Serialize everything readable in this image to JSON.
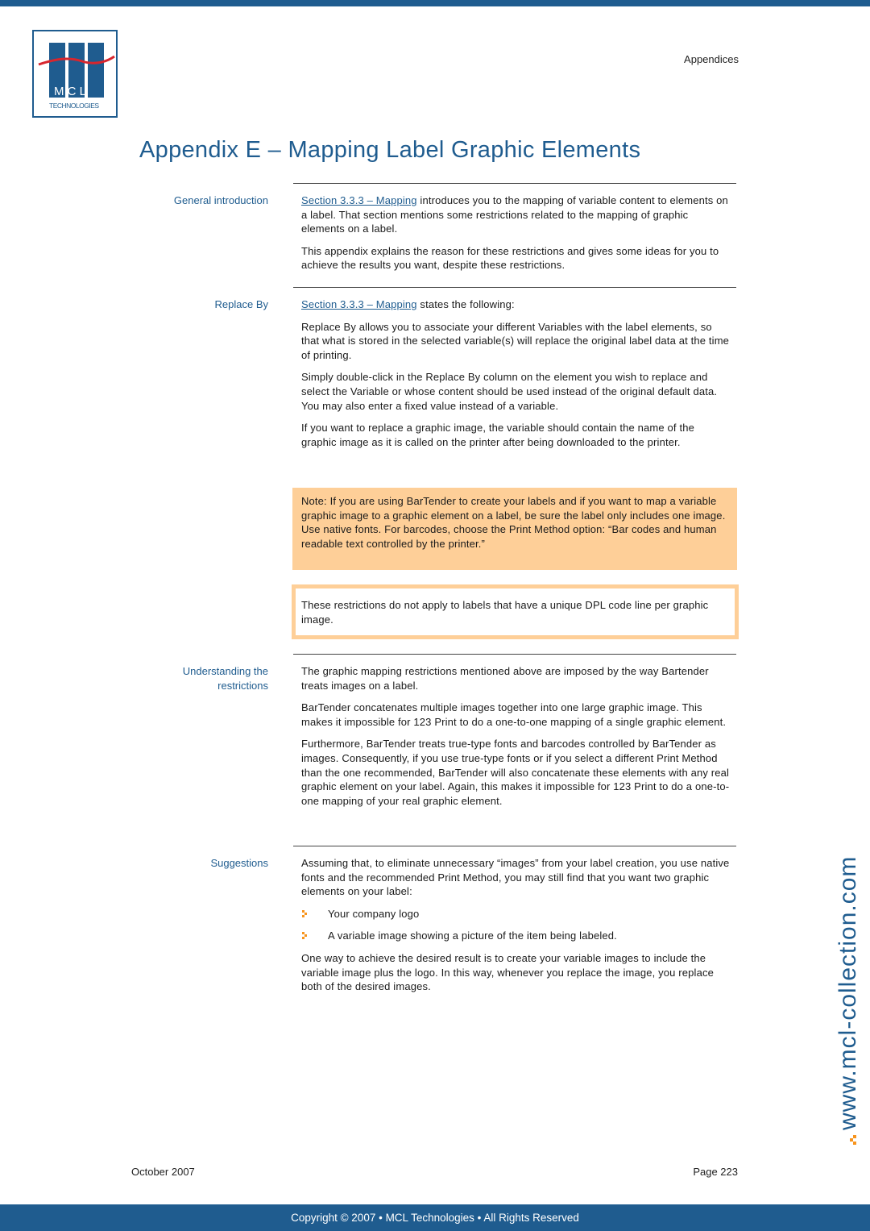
{
  "header": {
    "logo": {
      "letters": "M C L",
      "subtitle": "TECHNOLOGIES"
    },
    "section": "Appendices"
  },
  "title": "Appendix E – Mapping Label Graphic Elements",
  "sections": {
    "general_intro": {
      "label": "General introduction",
      "p1_link": "Section 3.3.3 – Mapping",
      "p1_rest": " introduces you to the mapping of variable content to elements on a label. That section mentions some restrictions related to the mapping of graphic elements on a label.",
      "p2": "This appendix explains the reason for these restrictions and gives some ideas for you to achieve the results you want, despite these restrictions."
    },
    "replace_by": {
      "label": "Replace By",
      "p1_link": "Section 3.3.3 – Mapping",
      "p1_rest": " states the following:",
      "p2": "Replace By allows you to associate your different Variables with the label elements, so that what is stored in the selected variable(s) will replace the original label data at the time of printing.",
      "p3": "Simply double-click in the Replace By column on the element you wish to replace and select the Variable or whose content should be used instead of the original default data. You may also enter a fixed value instead of a variable.",
      "p4": "If you want to replace a graphic image, the variable should contain the name of the graphic image as it is called on the printer after being downloaded to the printer.",
      "note": "Note: If you are using BarTender to create your labels and if you want to map a variable graphic image to a graphic element on a label, be sure the label only includes one image. Use native fonts. For barcodes, choose the Print Method option: “Bar codes and human readable text controlled by the printer.”",
      "callout": "These restrictions do not apply to labels that have a unique DPL code line per graphic image."
    },
    "understanding": {
      "label_line1": "Understanding the",
      "label_line2": "restrictions",
      "p1": "The graphic mapping restrictions mentioned above are imposed by the way Bartender treats images on a label.",
      "p2": "BarTender concatenates multiple images together into one large graphic image. This makes it impossible for 123 Print to do a one-to-one mapping of a single graphic element.",
      "p3": "Furthermore, BarTender treats true-type fonts and barcodes controlled by BarTender as images. Consequently, if you use true-type fonts or if you select a different Print Method than the one recommended, BarTender will also concatenate these elements with any real graphic element on your label. Again, this makes it impossible for 123 Print to do a one-to-one mapping of your real graphic element."
    },
    "suggestions": {
      "label": "Suggestions",
      "p1": "Assuming that, to eliminate unnecessary “images” from your label creation, you use native fonts and the recommended Print Method, you may still find that you want two graphic elements on your label:",
      "bullets": [
        "Your company logo",
        "A variable image showing a picture of the item being labeled."
      ],
      "p2": "One way to achieve the desired result is to create your variable images to include the variable image plus the logo. In this way, whenever you replace the image, you replace both of the desired images."
    }
  },
  "side_url": "www.mcl-collection.com",
  "footer": {
    "date": "October 2007",
    "page": "Page 223",
    "copyright": "Copyright © 2007 • MCL Technologies • All Rights Reserved"
  },
  "colors": {
    "brand_blue": "#1f5c8f",
    "note_orange": "#fecf98",
    "accent_orange": "#f7941d",
    "logo_red": "#d7262e"
  }
}
